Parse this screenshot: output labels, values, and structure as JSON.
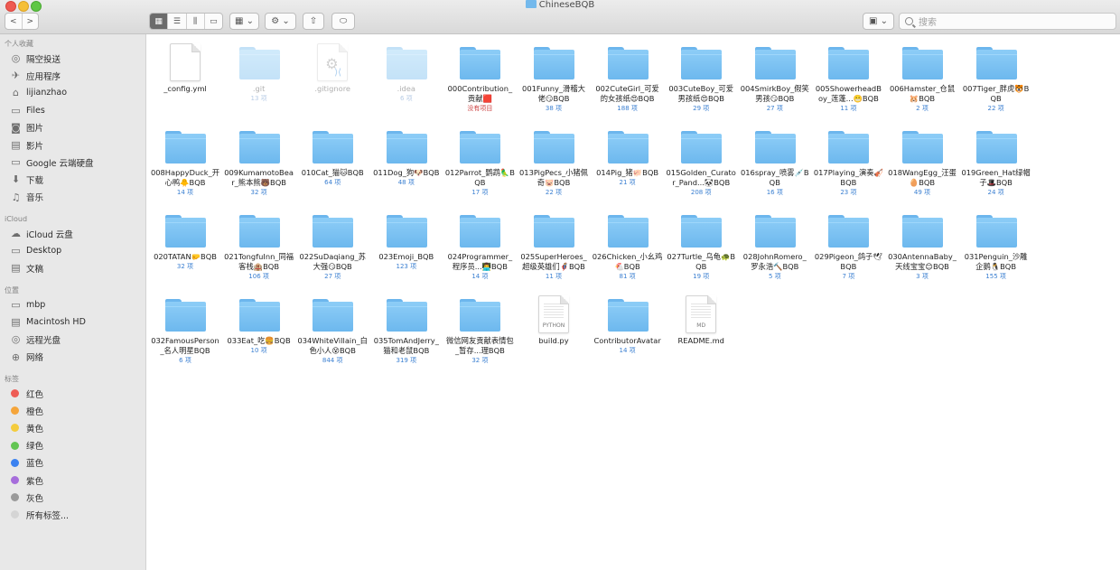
{
  "window": {
    "title": "ChineseBQB"
  },
  "toolbar": {
    "back_label": "<",
    "forward_label": ">",
    "view_modes": [
      "▦",
      "☰",
      "⫼",
      "▭"
    ],
    "arrange_label": "▦ ⌄",
    "action_label": "⚙ ⌄",
    "share_label": "⇧",
    "tag_label": "⬭",
    "dropbox_label": "▣ ⌄",
    "search_placeholder": "搜索"
  },
  "sidebar": {
    "favorites_title": "个人收藏",
    "favorites": [
      {
        "label": "隔空投送",
        "icon": "airdrop-icon",
        "glyph": "◎"
      },
      {
        "label": "应用程序",
        "icon": "applications-icon",
        "glyph": "✈"
      },
      {
        "label": "lijianzhao",
        "icon": "home-icon",
        "glyph": "⌂"
      },
      {
        "label": "Files",
        "icon": "folder-icon",
        "glyph": "▭"
      },
      {
        "label": "图片",
        "icon": "camera-icon",
        "glyph": "◙"
      },
      {
        "label": "影片",
        "icon": "film-icon",
        "glyph": "▤"
      },
      {
        "label": "Google 云端硬盘",
        "icon": "folder-icon",
        "glyph": "▭"
      },
      {
        "label": "下载",
        "icon": "download-icon",
        "glyph": "⬇"
      },
      {
        "label": "音乐",
        "icon": "music-icon",
        "glyph": "♫"
      }
    ],
    "icloud_title": "iCloud",
    "icloud": [
      {
        "label": "iCloud 云盘",
        "icon": "cloud-icon",
        "glyph": "☁"
      },
      {
        "label": "Desktop",
        "icon": "desktop-icon",
        "glyph": "▭"
      },
      {
        "label": "文稿",
        "icon": "document-icon",
        "glyph": "▤"
      }
    ],
    "locations_title": "位置",
    "locations": [
      {
        "label": "mbp",
        "icon": "laptop-icon",
        "glyph": "▭"
      },
      {
        "label": "Macintosh HD",
        "icon": "hard-drive-icon",
        "glyph": "▤"
      },
      {
        "label": "远程光盘",
        "icon": "disc-icon",
        "glyph": "◎"
      },
      {
        "label": "网络",
        "icon": "network-icon",
        "glyph": "⊕"
      }
    ],
    "tags_title": "标签",
    "tags": [
      {
        "label": "红色",
        "color": "#ee5c55"
      },
      {
        "label": "橙色",
        "color": "#f5a53b"
      },
      {
        "label": "黄色",
        "color": "#f4cc3e"
      },
      {
        "label": "绿色",
        "color": "#63c553"
      },
      {
        "label": "蓝色",
        "color": "#3b82f0"
      },
      {
        "label": "紫色",
        "color": "#a66ddb"
      },
      {
        "label": "灰色",
        "color": "#9a9a9a"
      },
      {
        "label": "所有标签...",
        "color": "#d5d5d5"
      }
    ]
  },
  "files": [
    {
      "name": "_config.yml",
      "count": "",
      "kind": "doc"
    },
    {
      "name": ".git",
      "count": "13 项",
      "kind": "folder",
      "faded": true
    },
    {
      "name": ".gitignore",
      "count": "",
      "kind": "gitignore",
      "faded": true
    },
    {
      "name": ".idea",
      "count": "6 项",
      "kind": "folder",
      "faded": true
    },
    {
      "name": "000Contribution_贡献🟥",
      "count": "没有项目",
      "kind": "folder",
      "countRed": true
    },
    {
      "name": "001Funny_滑稽大佬😏BQB",
      "count": "38 项",
      "kind": "folder"
    },
    {
      "name": "002CuteGirl_可爱的女孩纸😍BQB",
      "count": "188 项",
      "kind": "folder"
    },
    {
      "name": "003CuteBoy_可爱男孩纸😍BQB",
      "count": "29 项",
      "kind": "folder"
    },
    {
      "name": "004SmirkBoy_假笑男孩😏BQB",
      "count": "27 项",
      "kind": "folder"
    },
    {
      "name": "005ShowerheadBoy_莲蓬...😬BQB",
      "count": "11 项",
      "kind": "folder"
    },
    {
      "name": "006Hamster_仓鼠🐹BQB",
      "count": "2 项",
      "kind": "folder"
    },
    {
      "name": "007Tiger_胖虎🐯BQB",
      "count": "22 项",
      "kind": "folder"
    },
    {
      "name": "008HappyDuck_开心鸭🐥BQB",
      "count": "14 项",
      "kind": "folder"
    },
    {
      "name": "009KumamotoBear_熊本熊🐻BQB",
      "count": "32 项",
      "kind": "folder"
    },
    {
      "name": "010Cat_猫🐱BQB",
      "count": "64 项",
      "kind": "folder"
    },
    {
      "name": "011Dog_狗🐶BQB",
      "count": "48 项",
      "kind": "folder"
    },
    {
      "name": "012Parrot_鹦鹉🦜BQB",
      "count": "17 项",
      "kind": "folder"
    },
    {
      "name": "013PigPecs_小猪佩奇🐷BQB",
      "count": "22 项",
      "kind": "folder"
    },
    {
      "name": "014Pig_猪🐖BQB",
      "count": "21 项",
      "kind": "folder"
    },
    {
      "name": "015Golden_Curator_Pand...🐼BQB",
      "count": "208 项",
      "kind": "folder"
    },
    {
      "name": "016spray_喷雾💉BQB",
      "count": "16 项",
      "kind": "folder"
    },
    {
      "name": "017Playing_演奏🎻BQB",
      "count": "23 项",
      "kind": "folder"
    },
    {
      "name": "018WangEgg_汪蛋🥚BQB",
      "count": "49 项",
      "kind": "folder"
    },
    {
      "name": "019Green_Hat绿帽子🎩BQB",
      "count": "24 项",
      "kind": "folder"
    },
    {
      "name": "020TATAN🤛BQB",
      "count": "32 项",
      "kind": "folder"
    },
    {
      "name": "021TongfuInn_同福客栈🏨BQB",
      "count": "106 项",
      "kind": "folder"
    },
    {
      "name": "022SuDaqiang_苏大强😏BQB",
      "count": "27 项",
      "kind": "folder"
    },
    {
      "name": "023Emoji_BQB",
      "count": "123 项",
      "kind": "folder"
    },
    {
      "name": "024Programmer_程序员...👨‍💻BQB",
      "count": "14 项",
      "kind": "folder"
    },
    {
      "name": "025SuperHeroes_超级英雄们🦸BQB",
      "count": "11 项",
      "kind": "folder"
    },
    {
      "name": "026Chicken_小幺鸡🐔BQB",
      "count": "81 项",
      "kind": "folder"
    },
    {
      "name": "027Turtle_乌龟🐢BQB",
      "count": "19 项",
      "kind": "folder"
    },
    {
      "name": "028JohnRomero_罗永浩🔨BQB",
      "count": "5 项",
      "kind": "folder"
    },
    {
      "name": "029Pigeon_鸽子🕊BQB",
      "count": "7 项",
      "kind": "folder"
    },
    {
      "name": "030AntennaBaby_天线宝宝😊BQB",
      "count": "3 项",
      "kind": "folder"
    },
    {
      "name": "031Penguin_沙雕企鹅🐧BQB",
      "count": "155 项",
      "kind": "folder"
    },
    {
      "name": "032FamousPerson_名人明星BQB",
      "count": "6 项",
      "kind": "folder"
    },
    {
      "name": "033Eat_吃🍔BQB",
      "count": "10 项",
      "kind": "folder"
    },
    {
      "name": "034WhiteVillain_白色小人😵BQB",
      "count": "844 项",
      "kind": "folder"
    },
    {
      "name": "035TomAndJerry_猫和老鼠BQB",
      "count": "319 项",
      "kind": "folder"
    },
    {
      "name": "微信网友贡献表情包_暂存...理BQB",
      "count": "32 项",
      "kind": "folder"
    },
    {
      "name": "build.py",
      "count": "",
      "kind": "python",
      "label": "PYTHON"
    },
    {
      "name": "ContributorAvatar",
      "count": "14 项",
      "kind": "folder"
    },
    {
      "name": "README.md",
      "count": "",
      "kind": "md",
      "label": "MD"
    }
  ]
}
